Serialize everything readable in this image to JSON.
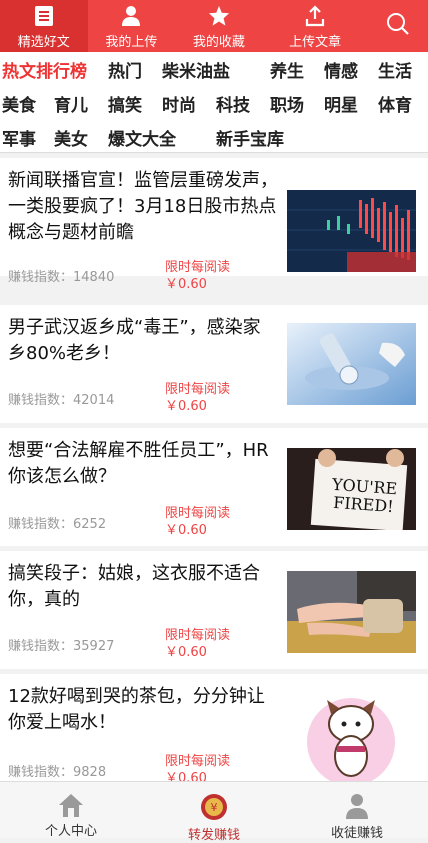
{
  "topnav": {
    "tabs": [
      {
        "label": "精选好文",
        "icon": "article-icon"
      },
      {
        "label": "我的上传",
        "icon": "person-icon"
      },
      {
        "label": "我的收藏",
        "icon": "star-icon"
      },
      {
        "label": "上传文章",
        "icon": "upload-icon"
      }
    ],
    "search_icon": "search-icon",
    "color": "#ee4444"
  },
  "categories": [
    "热文排行榜",
    "热门",
    "柴米油盐",
    "养生",
    "情感",
    "生活",
    "美食",
    "育儿",
    "搞笑",
    "时尚",
    "科技",
    "职场",
    "明星",
    "体育",
    "军事",
    "美女",
    "爆文大全",
    "新手宝库"
  ],
  "articles": [
    {
      "title": "新闻联播官宣！监管层重磅发声，一类股要疯了！3月18日股市热点概念与题材前瞻",
      "index_label": "赚钱指数：",
      "index_value": "14840",
      "reward_line1": "限时每阅读",
      "reward_line2": "￥0.60",
      "thumb": "stock-chart-image"
    },
    {
      "title": "男子武汉返乡成“毒王”，感染家乡80%老乡！",
      "index_label": "赚钱指数：",
      "index_value": "42014",
      "reward_line1": "限时每阅读",
      "reward_line2": "￥0.60",
      "thumb": "microscope-image"
    },
    {
      "title": "想要“合法解雇不胜任员工”，HR你该怎么做？",
      "index_label": "赚钱指数：",
      "index_value": "6252",
      "reward_line1": "限时每阅读",
      "reward_line2": "￥0.60",
      "thumb": "you-re-fired-sign-image",
      "sign_text": "YOU'RE FIRED!"
    },
    {
      "title": "搞笑段子：姑娘，这衣服不适合你，真的",
      "index_label": "赚钱指数：",
      "index_value": "35927",
      "reward_line1": "限时每阅读",
      "reward_line2": "￥0.60",
      "thumb": "woman-legs-image"
    },
    {
      "title": "12款好喝到哭的茶包，分分钟让你爱上喝水！",
      "index_label": "赚钱指数：",
      "index_value": "9828",
      "reward_line1": "限时每阅读",
      "reward_line2": "￥0.60",
      "thumb": "cartoon-cat-image"
    }
  ],
  "bottombar": {
    "tabs": [
      {
        "label": "个人中心",
        "icon": "home-icon"
      },
      {
        "label": "转发赚钱",
        "icon": "money-bag-icon"
      },
      {
        "label": "收徒赚钱",
        "icon": "apprentice-icon"
      }
    ]
  }
}
